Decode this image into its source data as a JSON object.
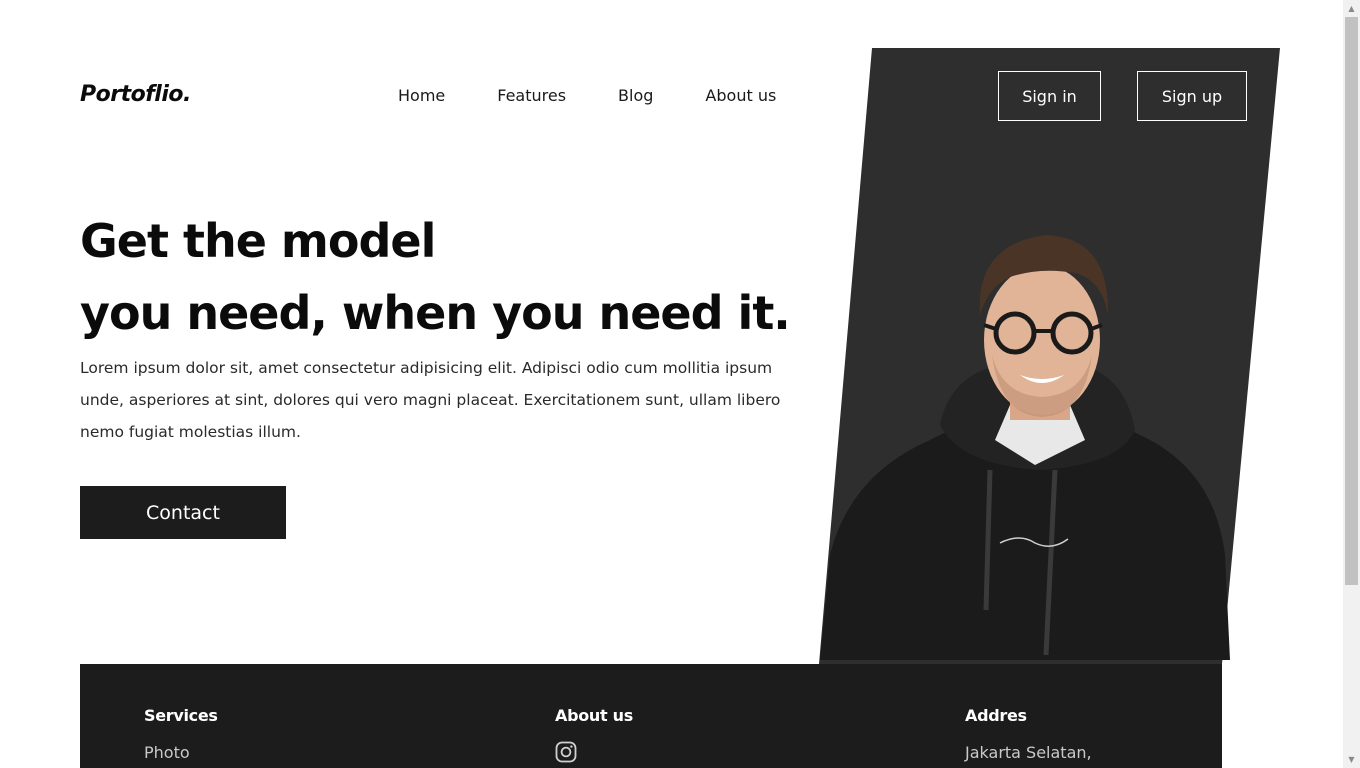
{
  "header": {
    "logo": "Portoflio.",
    "nav": [
      "Home",
      "Features",
      "Blog",
      "About us"
    ],
    "signin_label": "Sign in",
    "signup_label": "Sign up"
  },
  "hero": {
    "title_line1": "Get the model",
    "title_line2": "you need, when you need it.",
    "description": "Lorem ipsum dolor sit, amet consectetur adipisicing elit. Adipisci odio cum mollitia ipsum unde, asperiores at sint, dolores qui vero magni placeat. Exercitationem sunt, ullam libero nemo fugiat molestias illum.",
    "contact_label": "Contact"
  },
  "footer": {
    "services": {
      "heading": "Services",
      "first_item": "Photo"
    },
    "about": {
      "heading": "About us",
      "icon": "instagram-icon"
    },
    "address": {
      "heading": "Addres",
      "first_line": "Jakarta Selatan,"
    }
  },
  "colors": {
    "panel": "#2e2e2e",
    "footer": "#1d1c1d",
    "button": "#1c1c1c",
    "text": "#0b0b0b"
  }
}
